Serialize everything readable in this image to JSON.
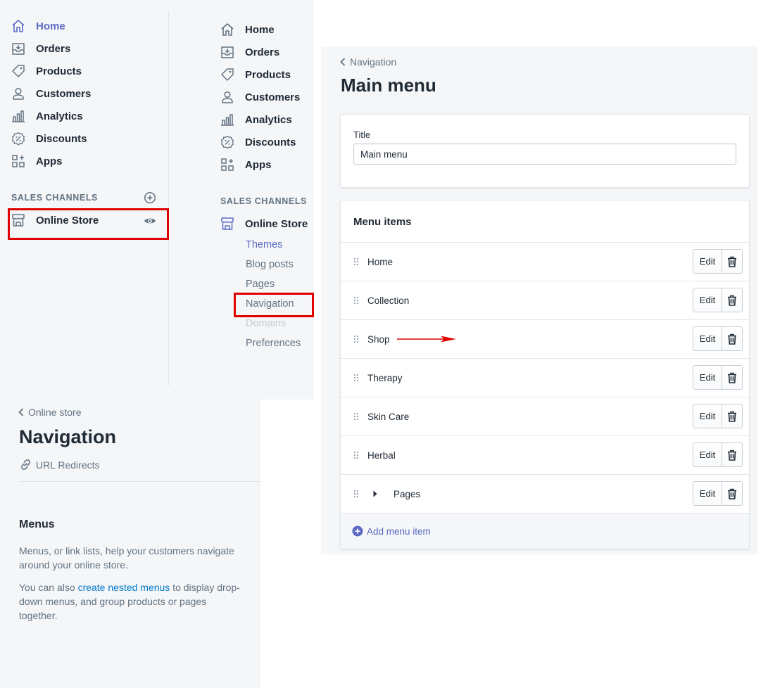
{
  "sidebar_collapsed": {
    "items": [
      {
        "label": "Home",
        "icon": "home-icon",
        "active": true
      },
      {
        "label": "Orders",
        "icon": "orders-icon"
      },
      {
        "label": "Products",
        "icon": "tag-icon"
      },
      {
        "label": "Customers",
        "icon": "person-icon"
      },
      {
        "label": "Analytics",
        "icon": "bar-chart-icon"
      },
      {
        "label": "Discounts",
        "icon": "discount-icon"
      },
      {
        "label": "Apps",
        "icon": "apps-icon"
      }
    ],
    "sales_channels_heading": "SALES CHANNELS",
    "online_store_label": "Online Store"
  },
  "sidebar_expanded": {
    "items": [
      {
        "label": "Home",
        "icon": "home-icon"
      },
      {
        "label": "Orders",
        "icon": "orders-icon"
      },
      {
        "label": "Products",
        "icon": "tag-icon"
      },
      {
        "label": "Customers",
        "icon": "person-icon"
      },
      {
        "label": "Analytics",
        "icon": "bar-chart-icon"
      },
      {
        "label": "Discounts",
        "icon": "discount-icon"
      },
      {
        "label": "Apps",
        "icon": "apps-icon"
      }
    ],
    "sales_channels_heading": "SALES CHANNELS",
    "online_store_label": "Online Store",
    "sub_items": [
      {
        "label": "Themes",
        "state": "active"
      },
      {
        "label": "Blog posts",
        "state": "normal"
      },
      {
        "label": "Pages",
        "state": "normal"
      },
      {
        "label": "Navigation",
        "state": "highlighted"
      },
      {
        "label": "Domains",
        "state": "disabled"
      },
      {
        "label": "Preferences",
        "state": "normal"
      }
    ]
  },
  "navigation_page": {
    "back_label": "Online store",
    "title": "Navigation",
    "url_redirects_label": "URL Redirects",
    "menus_heading": "Menus",
    "menus_description": "Menus, or link lists, help your customers navigate around your online store.",
    "nested_prefix": "You can also ",
    "nested_link": "create nested menus",
    "nested_suffix": " to display drop-down menus, and group products or pages together."
  },
  "main_menu_page": {
    "back_label": "Navigation",
    "title": "Main menu",
    "title_field_label": "Title",
    "title_field_value": "Main menu",
    "menu_items_heading": "Menu items",
    "menu_items": [
      {
        "label": "Home"
      },
      {
        "label": "Collection"
      },
      {
        "label": "Shop"
      },
      {
        "label": "Therapy"
      },
      {
        "label": "Skin Care"
      },
      {
        "label": "Herbal"
      },
      {
        "label": "Pages",
        "has_children": true
      }
    ],
    "edit_label": "Edit",
    "add_menu_item_label": "Add menu item"
  },
  "colors": {
    "accent": "#5c6ac4",
    "link": "#007ace",
    "highlight": "#e00000",
    "background": "#f4f6f8"
  }
}
